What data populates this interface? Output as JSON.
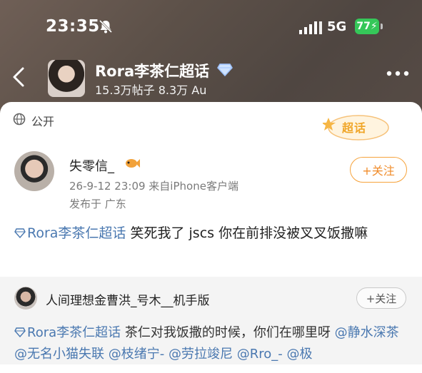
{
  "status_bar": {
    "time": "23:35",
    "network": "5G",
    "battery": "77"
  },
  "header": {
    "group_title": "Rora李茶仁超话",
    "group_stats": "15.3万帖子 8.3万 Au"
  },
  "post": {
    "visibility": "公开",
    "supertopic_badge": "超话",
    "author": {
      "name": "失零信_"
    },
    "follow_label": "+关注",
    "meta": "26-9-12 23:09  来自iPhone客户端",
    "location": "发布于 广东",
    "topic": "Rora李茶仁超话",
    "text": " 笑死我了 jscs 你在前排没被叉叉饭撒嘛"
  },
  "repost": {
    "name": "人间理想金曹洪_号木__机手版",
    "follow_label": "+关注",
    "topic": "Rora李茶仁超话",
    "text": " 茶仁对我饭撒的时候，你们在哪里呀 ",
    "mentions": [
      "@静水深茶",
      "@无名小猫失联",
      "@枝绪宁-",
      "@劳拉竣尼",
      "@Rro_-",
      "@极"
    ]
  },
  "colors": {
    "accent_orange": "#f08c2b",
    "link_blue": "#4a78b0",
    "battery_green": "#35c759"
  },
  "icons": [
    "bell-off-icon",
    "signal-icon",
    "back-icon",
    "diamond-icon",
    "more-icon",
    "globe-icon",
    "fish-emoji-icon"
  ]
}
